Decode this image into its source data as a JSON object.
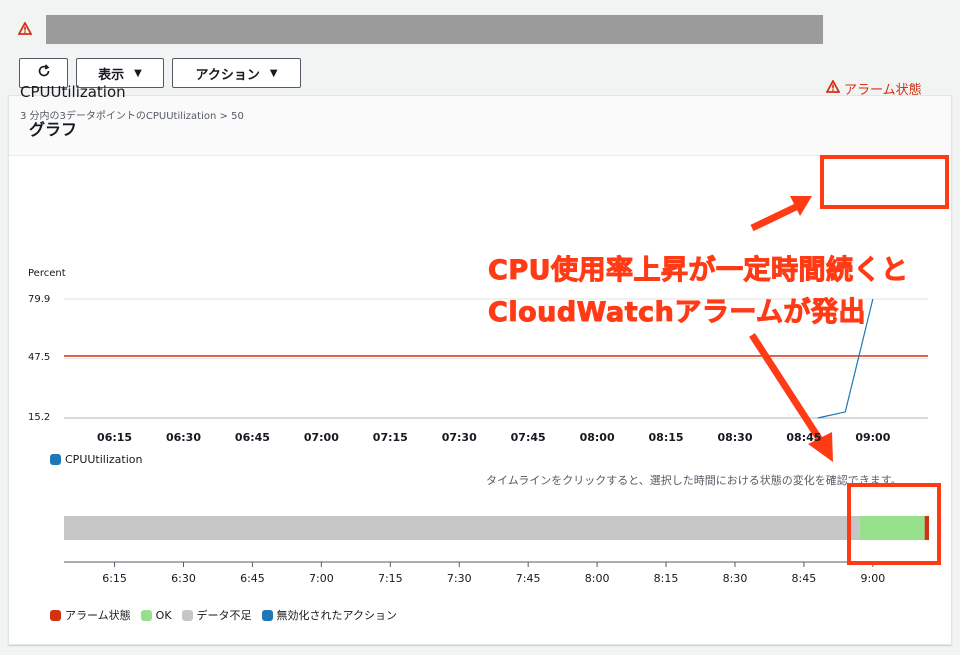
{
  "toolbar": {
    "view_label": "表示",
    "action_label": "アクション"
  },
  "panel": {
    "title": "グラフ",
    "metric_title": "CPUUtilization",
    "metric_subtitle": "3 分内の3データポイントのCPUUtilization > 50",
    "alarm_state": "アラーム状態"
  },
  "annotation": {
    "line1": "CPU使用率上昇が一定時間続くと",
    "line2": "CloudWatchアラームが発出"
  },
  "chart_data": {
    "type": "line",
    "ylabel": "Percent",
    "yticks": [
      "79.9",
      "47.5",
      "15.2"
    ],
    "ylim": [
      15.2,
      79.9
    ],
    "x": [
      "06:15",
      "06:30",
      "06:45",
      "07:00",
      "07:15",
      "07:30",
      "07:45",
      "08:00",
      "08:15",
      "08:30",
      "08:45",
      "09:00"
    ],
    "threshold": 50,
    "series": [
      {
        "name": "CPUUtilization",
        "color": "#1f77b4",
        "points": [
          [
            "08:48",
            15.2
          ],
          [
            "08:54",
            18.5
          ],
          [
            "09:00",
            79.9
          ]
        ]
      }
    ],
    "legend": "CPUUtilization",
    "grid": true
  },
  "timeline": {
    "note": "タイムラインをクリックすると、選択した時間における状態の変化を確認できます。",
    "ticks": [
      "6:15",
      "6:30",
      "6:45",
      "7:00",
      "7:15",
      "7:30",
      "7:45",
      "8:00",
      "8:15",
      "8:30",
      "8:45",
      "9:00"
    ],
    "segments": [
      {
        "state": "データ不足",
        "fraction": 0.92,
        "color": "#c6c6c6"
      },
      {
        "state": "OK",
        "fraction": 0.075,
        "color": "#96e08b"
      },
      {
        "state": "アラーム状態",
        "fraction": 0.005,
        "color": "#d13212"
      }
    ],
    "legend": [
      {
        "label": "アラーム状態",
        "color": "#d13212"
      },
      {
        "label": "OK",
        "color": "#96e08b"
      },
      {
        "label": "データ不足",
        "color": "#c6c6c6"
      },
      {
        "label": "無効化されたアクション",
        "color": "#1f77b4"
      }
    ]
  },
  "colors": {
    "accent_red": "#ff3b16",
    "alarm_red": "#d13212",
    "series_blue": "#1f77b4"
  }
}
